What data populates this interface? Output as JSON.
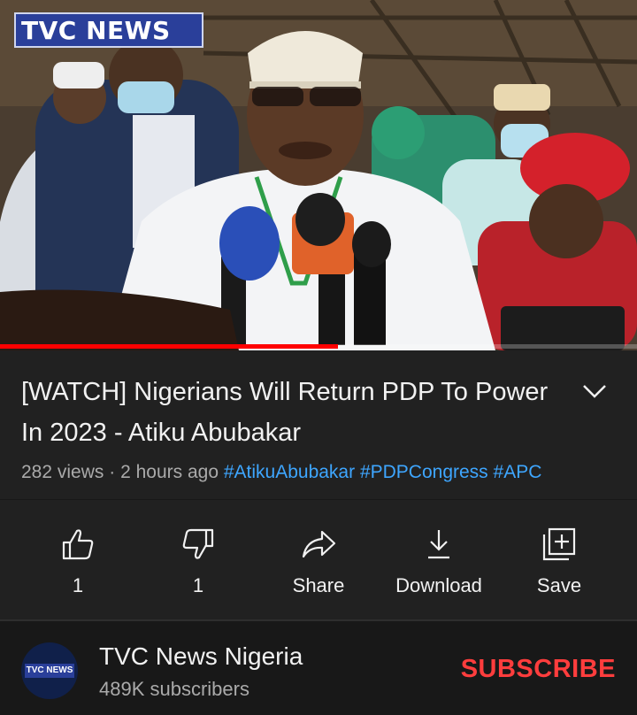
{
  "player": {
    "channel_bug": "TVC NEWS",
    "progress": 0.53
  },
  "video": {
    "title": "[WATCH] Nigerians Will Return PDP To Power In 2023 - Atiku Abubakar",
    "views": "282 views",
    "separator": "·",
    "age": "2 hours ago",
    "hashtags": [
      "#AtikuAbubakar",
      "#PDPCongress",
      "#APC"
    ]
  },
  "actions": [
    {
      "icon": "thumbs-up-icon",
      "label": "1"
    },
    {
      "icon": "thumbs-down-icon",
      "label": "1"
    },
    {
      "icon": "share-icon",
      "label": "Share"
    },
    {
      "icon": "download-icon",
      "label": "Download"
    },
    {
      "icon": "save-playlist-icon",
      "label": "Save"
    }
  ],
  "channel": {
    "avatar_text": "TVC NEWS",
    "name": "TVC News Nigeria",
    "subscribers": "489K subscribers",
    "subscribe_label": "SUBSCRIBE"
  },
  "colors": {
    "background": "#181818",
    "panel": "#212121",
    "hashtag": "#3ea6ff",
    "subscribe": "#ff3d3d",
    "progress": "#ff0000"
  }
}
